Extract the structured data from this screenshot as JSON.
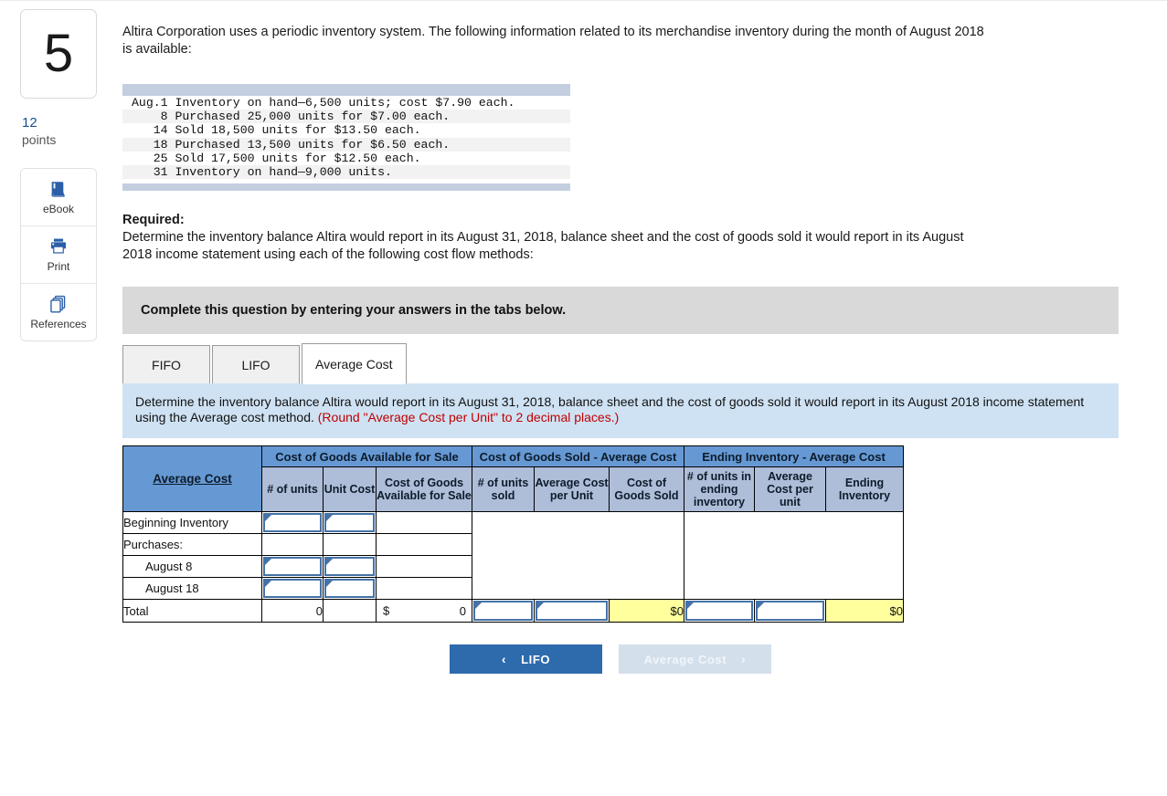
{
  "sidebar": {
    "question_number": "5",
    "points_value": "12",
    "points_label": "points",
    "tools": [
      {
        "label": "eBook",
        "icon": "book-icon"
      },
      {
        "label": "Print",
        "icon": "printer-icon"
      },
      {
        "label": "References",
        "icon": "references-icon"
      }
    ]
  },
  "question": {
    "intro": "Altira Corporation uses a periodic inventory system. The following information related to its merchandise inventory during the month of August 2018 is available:",
    "transactions": [
      {
        "date": "Aug.1",
        "text": "Inventory on hand—6,500 units; cost $7.90 each."
      },
      {
        "date": "8",
        "text": "Purchased 25,000 units for $7.00 each."
      },
      {
        "date": "14",
        "text": "Sold 18,500 units for $13.50 each."
      },
      {
        "date": "18",
        "text": "Purchased 13,500 units for $6.50 each."
      },
      {
        "date": "25",
        "text": "Sold 17,500 units for $12.50 each."
      },
      {
        "date": "31",
        "text": "Inventory on hand—9,000 units."
      }
    ],
    "required_heading": "Required:",
    "required_body": "Determine the inventory balance Altira would report in its August 31, 2018, balance sheet and the cost of goods sold it would report in its August 2018 income statement using each of the following cost flow methods:"
  },
  "callout": {
    "text": "Complete this question by entering your answers in the tabs below."
  },
  "tabs": [
    {
      "label": "FIFO",
      "active": false
    },
    {
      "label": "LIFO",
      "active": false
    },
    {
      "label": "Average Cost",
      "active": true
    }
  ],
  "instruction_panel": {
    "text": "Determine the inventory balance Altira would report in its August 31, 2018, balance sheet and the cost of goods sold it would report in its August 2018 income statement using the Average cost method. ",
    "round_note": "(Round \"Average Cost per Unit\" to 2 decimal places.)"
  },
  "table": {
    "corner_header": "Average Cost",
    "group_headers": [
      "Cost of Goods Available for Sale",
      "Cost of Goods Sold - Average Cost",
      "Ending Inventory - Average Cost"
    ],
    "sub_headers": [
      "# of units",
      "Unit Cost",
      "Cost of Goods Available for Sale",
      "# of units sold",
      "Average Cost per Unit",
      "Cost of Goods Sold",
      "# of units in ending inventory",
      "Average Cost per unit",
      "Ending Inventory"
    ],
    "rows": [
      {
        "label": "Beginning Inventory",
        "indent": false,
        "units_input": true,
        "unitcost_input": true
      },
      {
        "label": "Purchases:",
        "indent": false,
        "units_input": false,
        "unitcost_input": false
      },
      {
        "label": "August 8",
        "indent": true,
        "units_input": true,
        "unitcost_input": true
      },
      {
        "label": "August 18",
        "indent": true,
        "units_input": true,
        "unitcost_input": true
      }
    ],
    "total_row": {
      "label": "Total",
      "units_total": "0",
      "unit_cost_total": "",
      "cogafs_dollar": "$",
      "cogafs_total": "0",
      "cogs_dollar": "$",
      "cogs_total": "0",
      "ending_dollar": "$",
      "ending_total": "0"
    }
  },
  "nav": {
    "prev_label": "LIFO",
    "prev_chevron": "‹",
    "next_label": "Average Cost",
    "next_chevron": "›"
  }
}
